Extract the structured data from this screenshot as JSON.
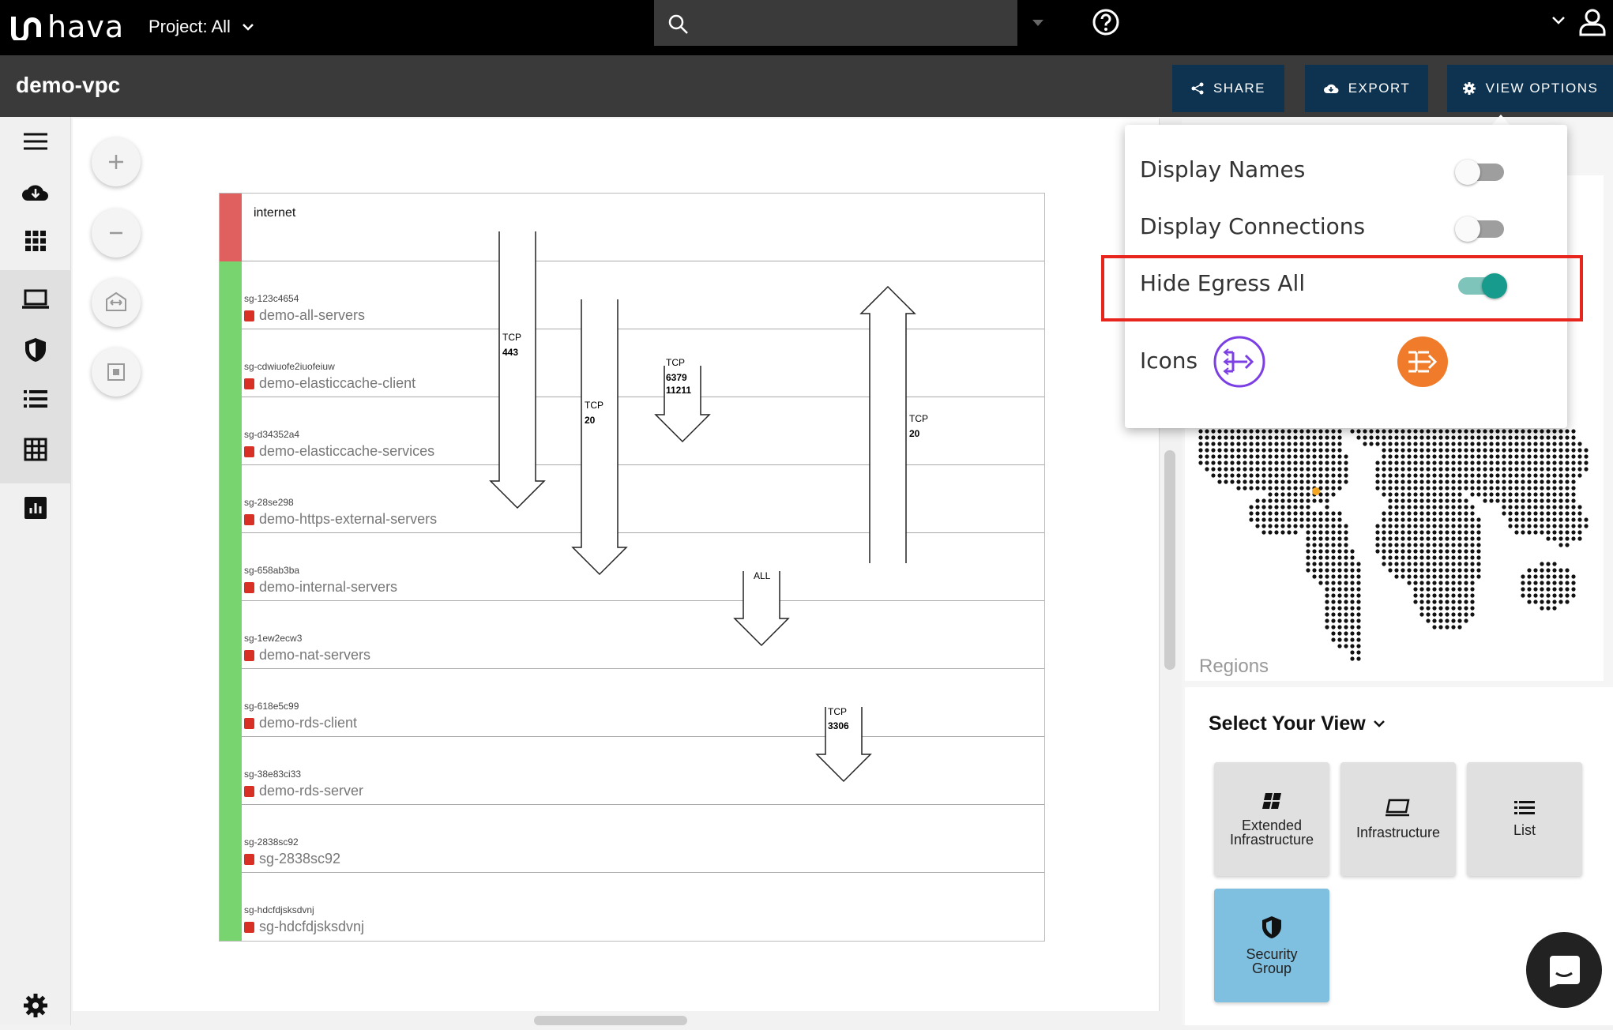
{
  "app": {
    "logo_text": "hava",
    "project_label": "Project: All"
  },
  "page": {
    "title": "demo-vpc"
  },
  "toolbar": {
    "share_label": "SHARE",
    "export_label": "EXPORT",
    "view_options_label": "VIEW OPTIONS"
  },
  "view_options": {
    "display_names": {
      "label": "Display Names",
      "enabled": false
    },
    "display_connections": {
      "label": "Display Connections",
      "enabled": false
    },
    "hide_egress_all": {
      "label": "Hide Egress All",
      "enabled": true
    },
    "icons_label": "Icons"
  },
  "diagram": {
    "internet_label": "internet",
    "groups": [
      {
        "id": "sg-123c4654",
        "name": "demo-all-servers"
      },
      {
        "id": "sg-cdwiuofe2iuofeiuw",
        "name": "demo-elasticcache-client"
      },
      {
        "id": "sg-d34352a4",
        "name": "demo-elasticcache-services"
      },
      {
        "id": "sg-28se298",
        "name": "demo-https-external-servers"
      },
      {
        "id": "sg-658ab3ba",
        "name": "demo-internal-servers"
      },
      {
        "id": "sg-1ew2ecw3",
        "name": "demo-nat-servers"
      },
      {
        "id": "sg-618e5c99",
        "name": "demo-rds-client"
      },
      {
        "id": "sg-38e83ci33",
        "name": "demo-rds-server"
      },
      {
        "id": "sg-2838sc92",
        "name": "sg-2838sc92"
      },
      {
        "id": "sg-hdcfdjsksdvnj",
        "name": "sg-hdcfdjsksdvnj"
      }
    ],
    "connections": [
      {
        "protocol": "TCP",
        "port": "443"
      },
      {
        "protocol": "TCP",
        "port": "20"
      },
      {
        "protocol": "TCP",
        "port": "6379",
        "port2": "11211"
      },
      {
        "protocol": "TCP",
        "port": "20"
      },
      {
        "protocol": "ALL"
      },
      {
        "protocol": "TCP",
        "port": "3306"
      }
    ]
  },
  "right_panel": {
    "regions_label": "Regions",
    "view_title": "Select Your View",
    "views": [
      {
        "line1": "Extended",
        "line2": "Infrastructure"
      },
      {
        "line1": "Infrastructure"
      },
      {
        "line1": "List"
      },
      {
        "line1": "Security",
        "line2": "Group"
      }
    ]
  },
  "colors": {
    "internet_bar": "#e06060",
    "group_bar": "#77d46f",
    "toggle_on": "#169b8c",
    "button_bg": "#0d3350",
    "highlight": "#e8251c"
  }
}
